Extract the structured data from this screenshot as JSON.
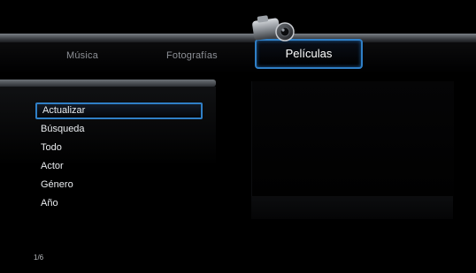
{
  "tabs": [
    {
      "label": "Música"
    },
    {
      "label": "Fotografías"
    },
    {
      "label": "Películas"
    }
  ],
  "active_tab_icon": "video-camera-icon",
  "menu": {
    "items": [
      {
        "label": "Actualizar",
        "selected": true
      },
      {
        "label": "Búsqueda"
      },
      {
        "label": "Todo"
      },
      {
        "label": "Actor"
      },
      {
        "label": "Género"
      },
      {
        "label": "Año"
      }
    ]
  },
  "pagination": {
    "text": "1/6"
  },
  "colors": {
    "background": "#000000",
    "accent": "#2f7fc6",
    "text": "#e9ecef",
    "inactive_tab": "#8d9096"
  }
}
